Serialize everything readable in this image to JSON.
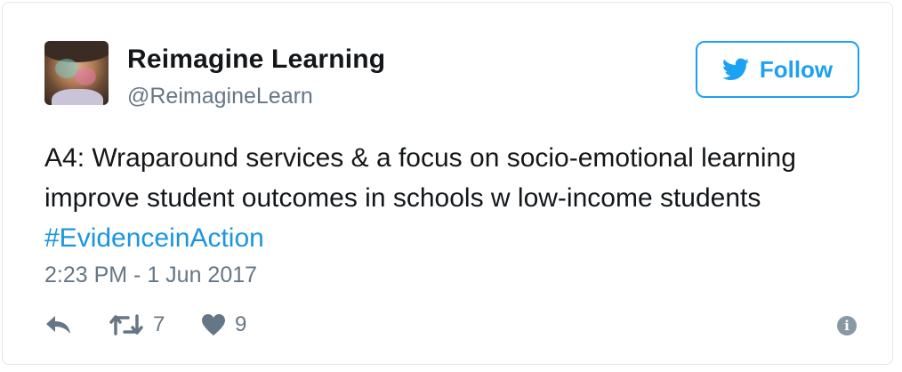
{
  "author": {
    "name": "Reimagine Learning",
    "handle": "@ReimagineLearn",
    "avatar_icon": "profile-photo"
  },
  "follow_button": {
    "label": "Follow",
    "icon": "twitter-bird-icon",
    "color": "#1da1f2"
  },
  "tweet": {
    "line1": "A4: Wraparound services & a focus on socio-emotional learning",
    "line2": "improve student outcomes in schools w low-income students",
    "hashtag": "#EvidenceinAction",
    "hashtag_color": "#1b95e0",
    "timestamp": "2:23 PM - 1 Jun 2017"
  },
  "actions": {
    "reply_icon": "reply-icon",
    "retweet_icon": "retweet-icon",
    "retweet_count": "7",
    "like_icon": "heart-icon",
    "like_count": "9",
    "info_icon": "info-icon"
  }
}
